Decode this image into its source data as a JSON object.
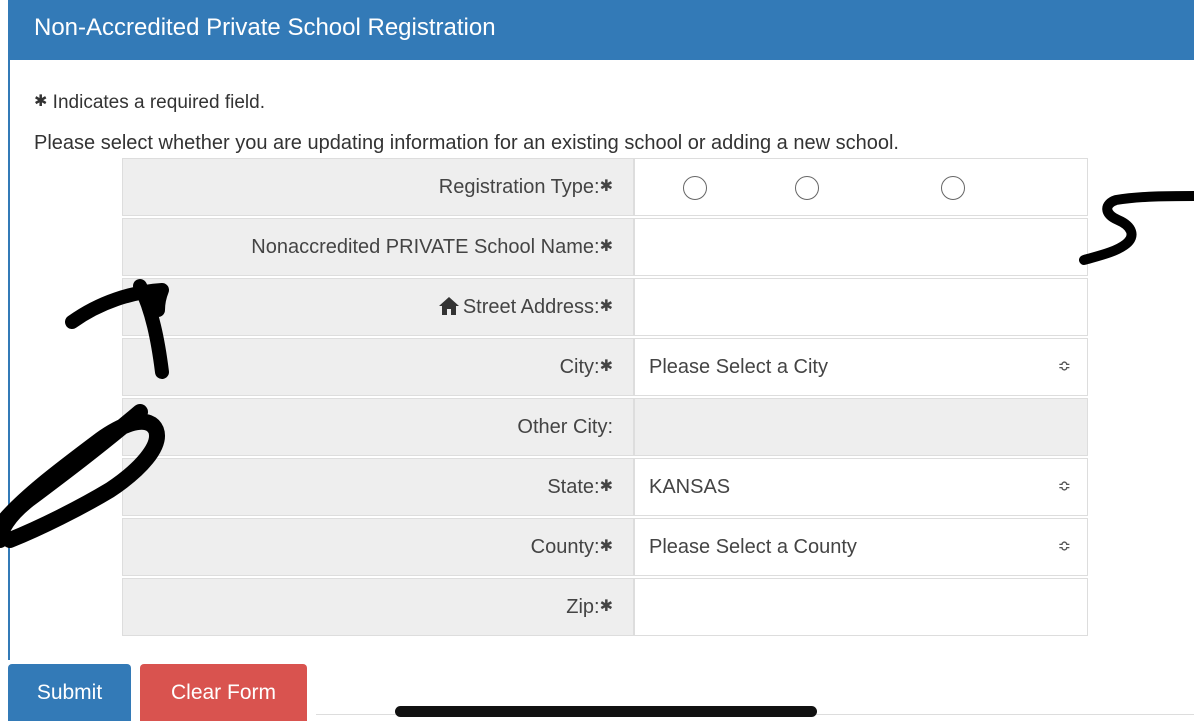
{
  "header": {
    "title": "Non-Accredited Private School Registration"
  },
  "notes": {
    "required_star": "✱",
    "required_text": " Indicates a required field.",
    "instructions": "Please select whether you are updating information for an existing school or adding a new school."
  },
  "form": {
    "registration_type_label": "Registration Type:",
    "school_name_label": "Nonaccredited PRIVATE School Name:",
    "street_address_label": "Street Address:",
    "city_label": "City:",
    "city_value": "Please Select a City",
    "other_city_label": "Other City:",
    "state_label": "State:",
    "state_value": "KANSAS",
    "county_label": "County:",
    "county_value": "Please Select a County",
    "zip_label": "Zip:",
    "req_marker": "✱",
    "select_arrow": "≎"
  },
  "buttons": {
    "submit_label": "Submit",
    "clear_label": "Clear Form"
  },
  "colors": {
    "header_bg": "#337ab7",
    "submit_bg": "#337ab7",
    "clear_bg": "#d9534f",
    "label_bg": "#eeeeee"
  },
  "icons": {
    "street_address": "home-icon",
    "select": "up-down-chevron-icon"
  }
}
